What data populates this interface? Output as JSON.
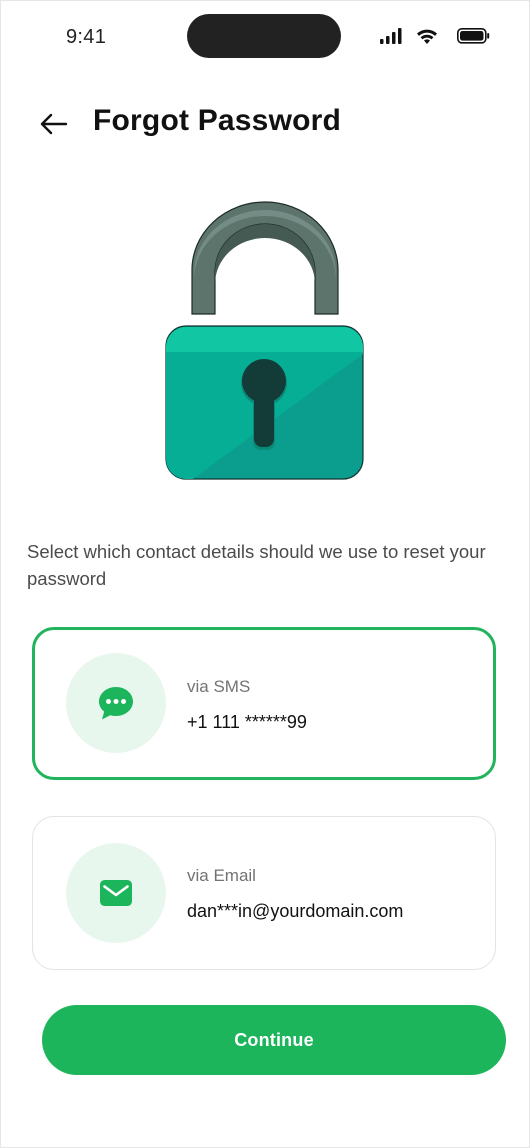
{
  "status_bar": {
    "time": "9:41"
  },
  "header": {
    "title": "Forgot Password",
    "back_icon": "arrow-left-icon"
  },
  "illustration": {
    "name": "padlock",
    "colors": {
      "shackle": "#5f756e",
      "body": "#0a9e8e",
      "body_top": "#0dc4a2",
      "keyhole": "#133b37"
    }
  },
  "instruction": "Select which contact details should we use to reset your password",
  "options": [
    {
      "label": "via SMS",
      "value": "+1 111 ******99",
      "icon": "chat-bubble-icon",
      "selected": true
    },
    {
      "label": "via Email",
      "value": "dan***in@yourdomain.com",
      "icon": "envelope-icon",
      "selected": false
    }
  ],
  "actions": {
    "continue_label": "Continue"
  },
  "colors": {
    "accent": "#1db55c",
    "accent_light": "#e8f7ee"
  }
}
